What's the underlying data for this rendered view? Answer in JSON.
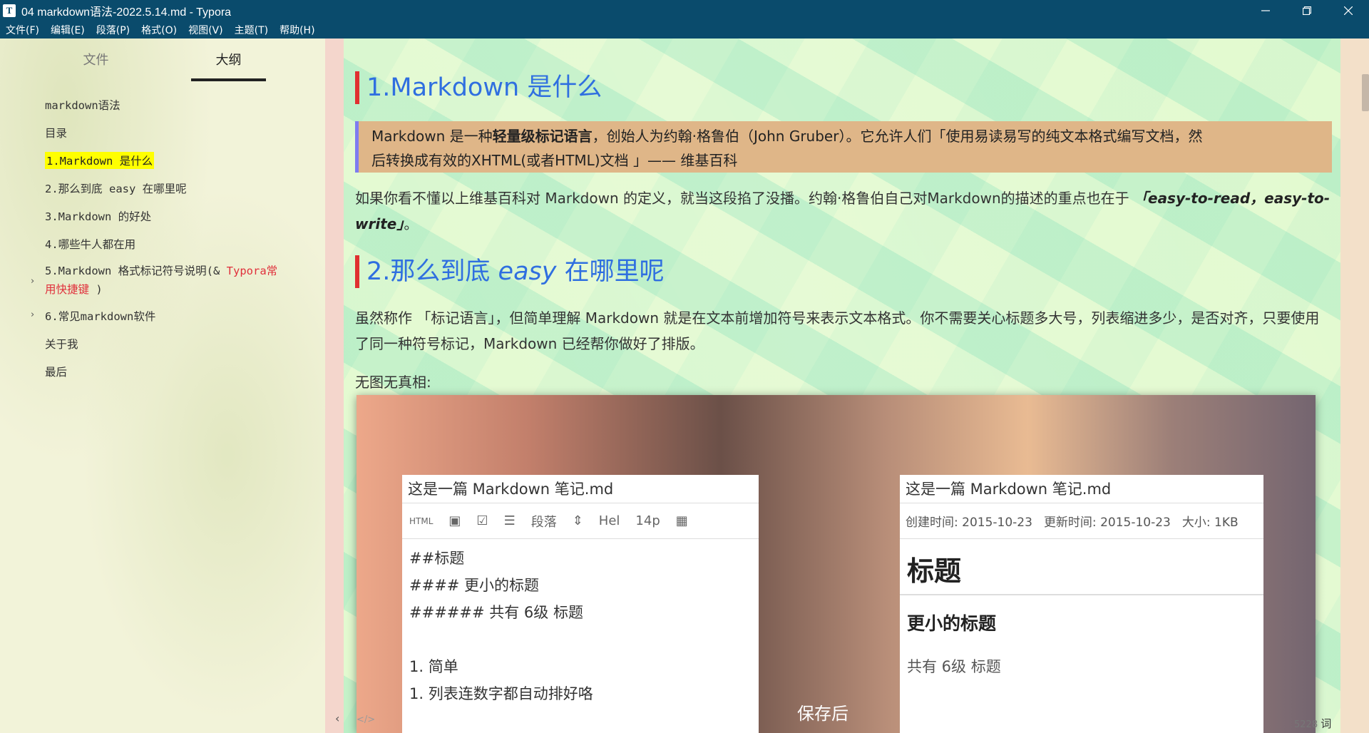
{
  "window": {
    "title": "04 markdown语法-2022.5.14.md - Typora",
    "app_icon": "T"
  },
  "menu": [
    "文件(F)",
    "编辑(E)",
    "段落(P)",
    "格式(O)",
    "视图(V)",
    "主题(T)",
    "帮助(H)"
  ],
  "sidebar": {
    "tabs": {
      "files": "文件",
      "outline": "大纲"
    },
    "items": [
      {
        "label": "markdown语法"
      },
      {
        "label": "目录"
      },
      {
        "label": "1.Markdown 是什么",
        "active": true
      },
      {
        "label": "2.那么到底 easy 在哪里呢"
      },
      {
        "label": "3.Markdown 的好处"
      },
      {
        "label": "4.哪些牛人都在用"
      },
      {
        "label_a": "5.Markdown 格式标记符号说明(& ",
        "label_red": "Typora常",
        "label_red2": "用快捷键",
        "label_b": ")",
        "expandable": true
      },
      {
        "label": "6.常见markdown软件",
        "expandable": true
      },
      {
        "label": "关于我"
      },
      {
        "label": "最后"
      }
    ],
    "collapse_glyph": "‹"
  },
  "content": {
    "h1_a": "1.Markdown 是什么",
    "quote": {
      "pre": "Markdown 是一种",
      "bold": "轻量级标记语言",
      "mid": "，创始人为约翰·格鲁伯（John Gruber）。它允许人们「使用易读易写的纯文本格式编写文档，然",
      "line2": "后转换成有效的XHTML(或者HTML)文档 」—— 维基百科"
    },
    "para1": {
      "text": "如果你看不懂以上维基百科对 Markdown 的定义，就当这段掐了没播。约翰·格鲁伯自己对Markdown的描述的重点也在于",
      "em": "「easy-to-read，easy-to-write」",
      "end": "。"
    },
    "h1_b_pre": "2.那么到底 ",
    "h1_b_em": "easy",
    "h1_b_post": " 在哪里呢",
    "para2": "虽然称作 「标记语言」，但简单理解 Markdown 就是在文本前增加符号来表示文本格式。你不需要关心标题多大号，列表缩进多少，是否对齐，只要使用了同一种符号标记，Markdown 已经帮你做好了排版。",
    "para3": "无图无真相:",
    "embedded_image": {
      "left_title": "这是一篇 Markdown 笔记.md",
      "left_toolbar": [
        "HTML",
        "段落",
        "Hel",
        "14p"
      ],
      "left_lines": [
        "##标题",
        "#### 更小的标题",
        "###### 共有 6级 标题",
        "",
        "1. 简单",
        "1. 列表连数字都自动排好咯"
      ],
      "right_title": "这是一篇 Markdown 笔记.md",
      "right_meta": [
        "创建时间: 2015-10-23",
        "更新时间: 2015-10-23",
        "大小: 1KB"
      ],
      "right_h1": "标题",
      "right_h2": "更小的标题",
      "right_h3": "共有 6级 标题",
      "save_label": "保存后"
    }
  },
  "status": {
    "source_toggle": "</>",
    "word_count": "5228",
    "word_unit": "词"
  }
}
